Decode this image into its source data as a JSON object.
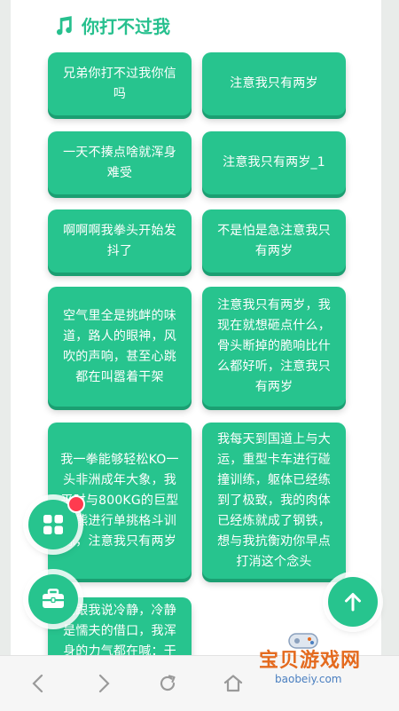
{
  "section": {
    "title": "你打不过我",
    "icon": "music-note-icon"
  },
  "cards": [
    "兄弟你打不过我你信吗",
    "注意我只有两岁",
    "一天不揍点啥就浑身难受",
    "注意我只有两岁_1",
    "啊啊啊我拳头开始发抖了",
    "不是怕是急注意我只有两岁",
    "空气里全是挑衅的味道，路人的眼神，风吹的声响，甚至心跳都在叫嚣着干架",
    "注意我只有两岁，我现在就想砸点什么，骨头断掉的脆响比什么都好听，注意我只有两岁",
    "我一拳能够轻松KO一头非洲成年大象，我平时与800KG的巨型棕熊进行单挑格斗训练，注意我只有两岁",
    "我每天到国道上与大运，重型卡车进行碰撞训练，躯体已经练到了极致，我的肉体已经炼就成了钢铁，想与我抗衡劝你早点打消这个念头",
    "别跟我说冷静，冷静是懦夫的借口，我浑身的力气都在喊：干架"
  ],
  "fabs": {
    "grid": "grid-icon",
    "toolbox": "toolbox-icon",
    "top": "arrow-up-icon"
  },
  "colors": {
    "accent": "#27c48e",
    "badge": "#ff3b4f"
  },
  "watermark": {
    "title": "宝贝游戏网",
    "url": "baobeiy.com"
  }
}
